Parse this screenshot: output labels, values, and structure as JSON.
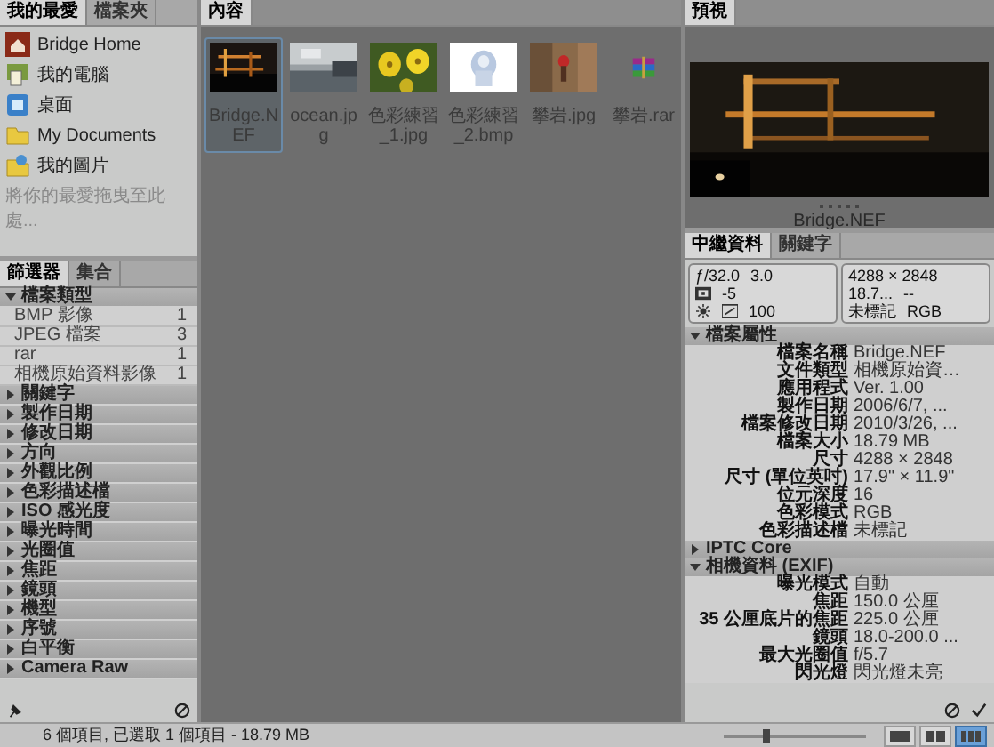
{
  "left_tabs": [
    {
      "label": "我的最愛",
      "selected": true
    },
    {
      "label": "檔案夾",
      "selected": false
    }
  ],
  "favorites": [
    {
      "label": "Bridge Home",
      "kind": "home"
    },
    {
      "label": "我的電腦",
      "kind": "computer"
    },
    {
      "label": "桌面",
      "kind": "desktop"
    },
    {
      "label": "My Documents",
      "kind": "folder"
    },
    {
      "label": "我的圖片",
      "kind": "pictures"
    }
  ],
  "favorites_hint": "將你的最愛拖曳至此處...",
  "filter_tabs": [
    {
      "label": "篩選器",
      "selected": true
    },
    {
      "label": "集合",
      "selected": false
    }
  ],
  "filters": [
    {
      "label": "檔案類型",
      "expanded": true,
      "children": [
        {
          "label": "BMP 影像",
          "count": "1"
        },
        {
          "label": "JPEG 檔案",
          "count": "3"
        },
        {
          "label": "rar",
          "count": "1"
        },
        {
          "label": "相機原始資料影像",
          "count": "1"
        }
      ]
    },
    {
      "label": "關鍵字",
      "expanded": false
    },
    {
      "label": "製作日期",
      "expanded": false
    },
    {
      "label": "修改日期",
      "expanded": false
    },
    {
      "label": "方向",
      "expanded": false
    },
    {
      "label": "外觀比例",
      "expanded": false
    },
    {
      "label": "色彩描述檔",
      "expanded": false
    },
    {
      "label": "ISO 感光度",
      "expanded": false
    },
    {
      "label": "曝光時間",
      "expanded": false
    },
    {
      "label": "光圈值",
      "expanded": false
    },
    {
      "label": "焦距",
      "expanded": false
    },
    {
      "label": "鏡頭",
      "expanded": false
    },
    {
      "label": "機型",
      "expanded": false
    },
    {
      "label": "序號",
      "expanded": false
    },
    {
      "label": "白平衡",
      "expanded": false
    },
    {
      "label": "Camera Raw",
      "expanded": false
    }
  ],
  "content_tabs": [
    {
      "label": "內容",
      "selected": true
    }
  ],
  "thumbnails": [
    {
      "name": "Bridge.NEF",
      "selected": true
    },
    {
      "name": "ocean.jpg",
      "selected": false
    },
    {
      "name": "色彩練習_1.jpg",
      "selected": false
    },
    {
      "name": "色彩練習_2.bmp",
      "selected": false
    },
    {
      "name": "攀岩.jpg",
      "selected": false
    },
    {
      "name": "攀岩.rar",
      "kind": "archive",
      "selected": false
    }
  ],
  "preview_tabs": [
    {
      "label": "預視",
      "selected": true
    }
  ],
  "preview": {
    "name": "Bridge.NEF"
  },
  "meta_tabs": [
    {
      "label": "中繼資料",
      "selected": true
    },
    {
      "label": "關鍵字",
      "selected": false
    }
  ],
  "camera_summary": {
    "aperture": "ƒ/32.0",
    "shutter": "3.0",
    "exposure_comp": "-5",
    "iso": "100"
  },
  "file_summary": {
    "dimensions": "4288 × 2848",
    "size": "18.7...",
    "resolution": "--",
    "label": "未標記",
    "mode": "RGB"
  },
  "metadata": [
    {
      "label": "檔案屬性",
      "expanded": true,
      "rows": [
        {
          "label": "檔案名稱",
          "value": "Bridge.NEF"
        },
        {
          "label": "文件類型",
          "value": "相機原始資…"
        },
        {
          "label": "應用程式",
          "value": "Ver. 1.00"
        },
        {
          "label": "製作日期",
          "value": "2006/6/7, ..."
        },
        {
          "label": "檔案修改日期",
          "value": "2010/3/26, ..."
        },
        {
          "label": "檔案大小",
          "value": "18.79 MB"
        },
        {
          "label": "尺寸",
          "value": "4288 × 2848"
        },
        {
          "label": "尺寸 (單位英吋)",
          "value": "17.9\" × 11.9\""
        },
        {
          "label": "位元深度",
          "value": "16"
        },
        {
          "label": "色彩模式",
          "value": "RGB"
        },
        {
          "label": "色彩描述檔",
          "value": "未標記"
        }
      ]
    },
    {
      "label": "IPTC Core",
      "expanded": false
    },
    {
      "label": "相機資料 (EXIF)",
      "expanded": true,
      "rows": [
        {
          "label": "曝光模式",
          "value": "自動"
        },
        {
          "label": "焦距",
          "value": "150.0 公厘"
        },
        {
          "label": "35 公厘底片的焦距",
          "value": "225.0 公厘"
        },
        {
          "label": "鏡頭",
          "value": "18.0-200.0 ..."
        },
        {
          "label": "最大光圈值",
          "value": "f/5.7"
        },
        {
          "label": "閃光燈",
          "value": "閃光燈未亮"
        }
      ]
    }
  ],
  "status": "6 個項目, 已選取 1 個項目 - 18.79 MB",
  "zoom_slider": {
    "level": 0.3
  },
  "view_modes": [
    {
      "selected": false
    },
    {
      "selected": false
    },
    {
      "selected": true
    }
  ]
}
